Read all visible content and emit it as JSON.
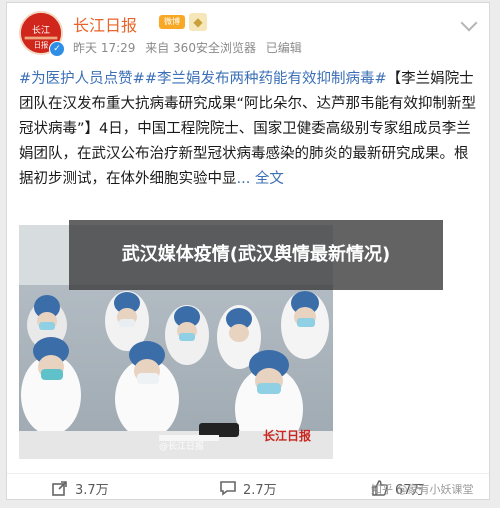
{
  "account": {
    "name": "长江日报",
    "badge": "微博",
    "time": "昨天 17:29",
    "source": "来自 360安全浏览器",
    "edited": "已编辑",
    "avatar_text": "长江日报",
    "verified_mark": "✓"
  },
  "post": {
    "topic1": "#为医护人员点赞#",
    "topic2": "#李兰娟发布两种药能有效抑制病毒#",
    "text": "【李兰娟院士团队在汉发布重大抗病毒研究成果“阿比朵尔、达芦那韦能有效抑制新型冠状病毒”】4日，中国工程院院士、国家卫健委高级别专家组成员李兰娟团队，在武汉公布治疗新型冠状病毒感染的肺炎的最新研究成果。根据初步测试，在体外细胞实验中显",
    "more": "... 全文"
  },
  "overlay": {
    "title": "武汉媒体疫情(武汉舆情最新情况)"
  },
  "photo": {
    "watermark": "长江日报",
    "credit": "@长江日报"
  },
  "actions": {
    "share_count": "3.7万",
    "comment_count": "2.7万",
    "like_count": "67万"
  },
  "footer": {
    "zhihu_label": "知乎 @家有小妖课堂"
  },
  "colors": {
    "brand_orange": "#e8642a",
    "topic_blue": "#3b6fb6",
    "avatar_red": "#d0261b"
  }
}
